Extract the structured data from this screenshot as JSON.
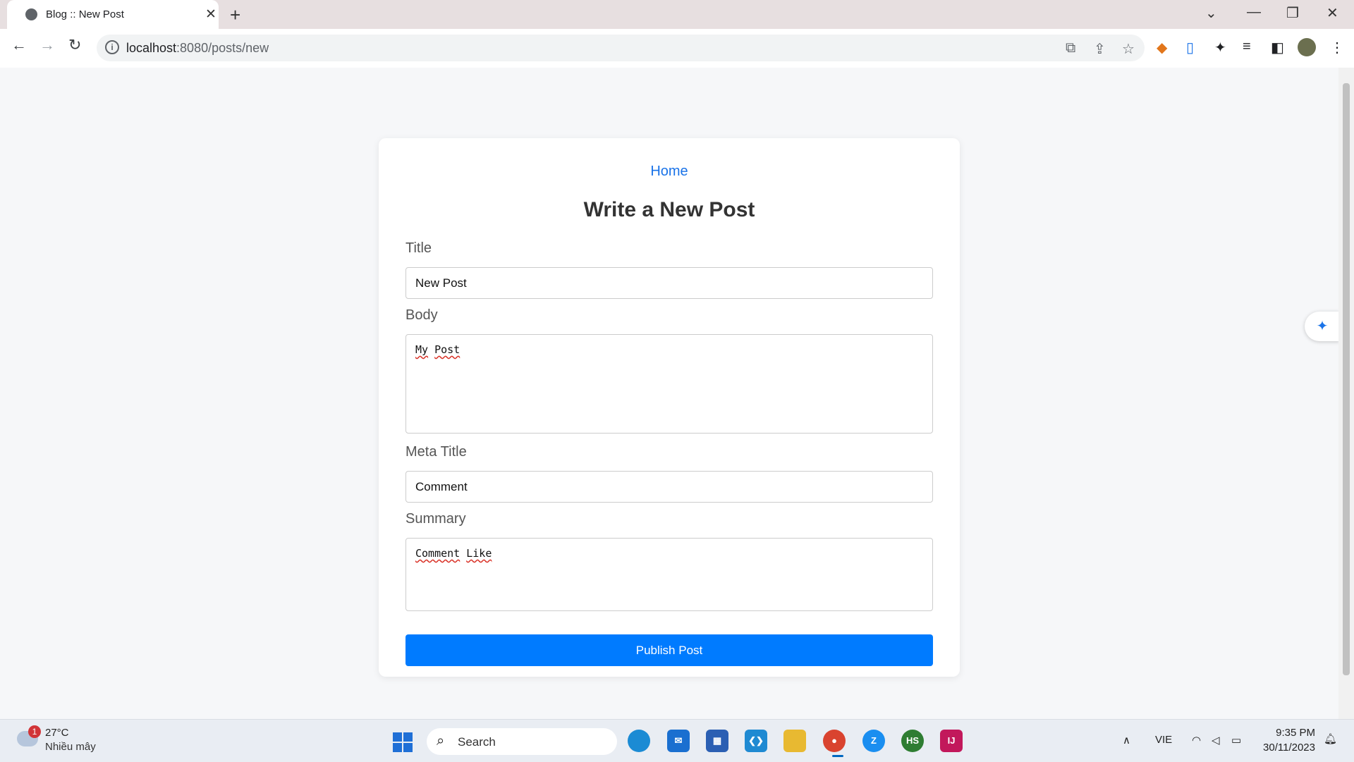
{
  "browser": {
    "tab_title": "Blog :: New Post",
    "url_host": "localhost",
    "url_path": ":8080/posts/new"
  },
  "page": {
    "home_link": "Home",
    "heading": "Write a New Post",
    "title_label": "Title",
    "title_value": "New Post",
    "body_label": "Body",
    "body_word1": "My",
    "body_word2": "Post",
    "meta_label": "Meta Title",
    "meta_value": "Comment",
    "summary_label": "Summary",
    "summary_word1": "Comment",
    "summary_word2": "Like",
    "publish_label": "Publish Post"
  },
  "taskbar": {
    "weather_badge": "1",
    "weather_temp": "27°C",
    "weather_desc": "Nhiều mây",
    "search_placeholder": "Search",
    "lang": "VIE",
    "time": "9:35 PM",
    "date": "30/11/2023",
    "apps": [
      "edge",
      "mail",
      "store",
      "vscode",
      "file-explorer",
      "chrome",
      "zalo",
      "hs",
      "intellij"
    ]
  }
}
